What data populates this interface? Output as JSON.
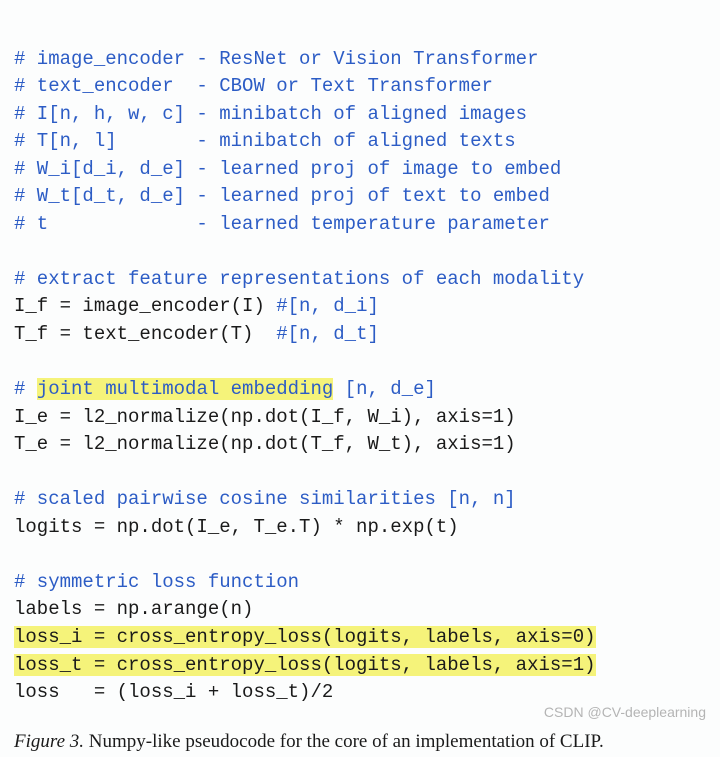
{
  "code": {
    "c1": "# image_encoder - ResNet or Vision Transformer",
    "c2": "# text_encoder  - CBOW or Text Transformer",
    "c3": "# I[n, h, w, c] - minibatch of aligned images",
    "c4": "# T[n, l]       - minibatch of aligned texts",
    "c5": "# W_i[d_i, d_e] - learned proj of image to embed",
    "c6": "# W_t[d_t, d_e] - learned proj of text to embed",
    "c7": "# t             - learned temperature parameter",
    "c8": "# extract feature representations of each modality",
    "l1a": "I_f = image_encoder(I) ",
    "l1b": "#[n, d_i]",
    "l2a": "T_f = text_encoder(T)  ",
    "l2b": "#[n, d_t]",
    "c9a": "# ",
    "c9hl": "joint multimodal embedding",
    "c9b": " [n, d_e]",
    "l3": "I_e = l2_normalize(np.dot(I_f, W_i), axis=1)",
    "l4": "T_e = l2_normalize(np.dot(T_f, W_t), axis=1)",
    "c10": "# scaled pairwise cosine similarities [n, n]",
    "l5": "logits = np.dot(I_e, T_e.T) * np.exp(t)",
    "c11": "# symmetric loss function",
    "l6": "labels = np.arange(n)",
    "l7": "loss_i = cross_entropy_loss(logits, labels, axis=0)",
    "l8": "loss_t = cross_entropy_loss(logits, labels, axis=1)",
    "l9": "loss   = (loss_i + loss_t)/2"
  },
  "caption": {
    "label": "Figure 3.",
    "text": " Numpy-like pseudocode for the core of an implementation of CLIP."
  },
  "watermark": "CSDN @CV-deeplearning"
}
